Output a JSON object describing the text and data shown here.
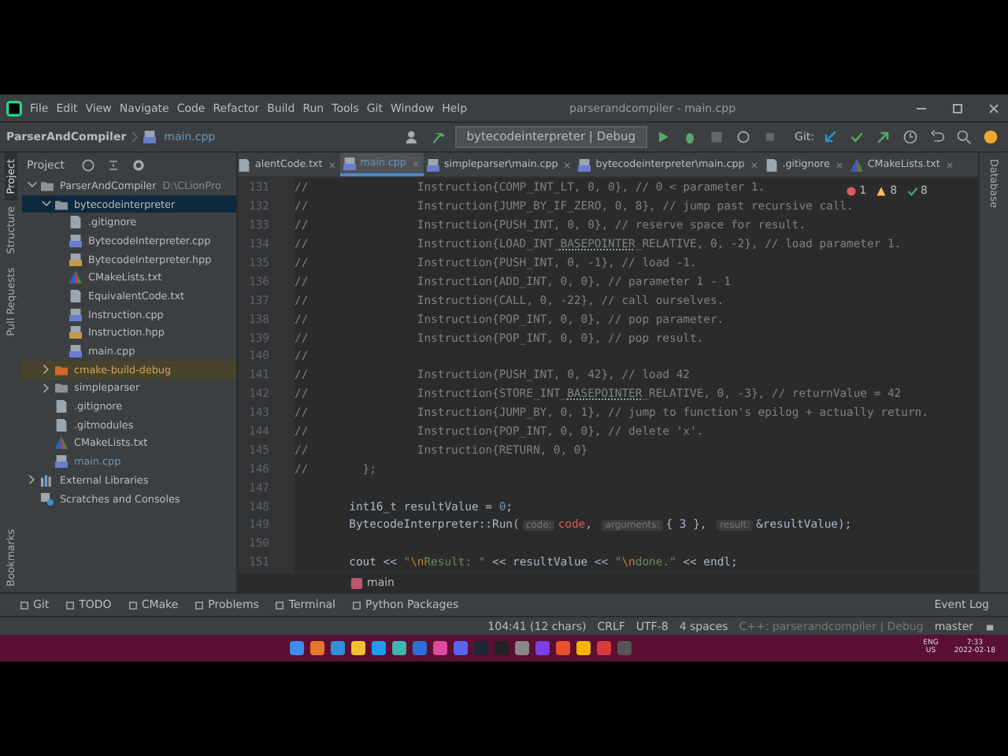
{
  "window": {
    "title": "parserandcompiler - main.cpp"
  },
  "menu": [
    "File",
    "Edit",
    "View",
    "Navigate",
    "Code",
    "Refactor",
    "Build",
    "Run",
    "Tools",
    "Git",
    "Window",
    "Help"
  ],
  "breadcrumb": [
    "ParserAndCompiler",
    "main.cpp"
  ],
  "run_config": "bytecodeinterpreter | Debug",
  "git_label": "Git:",
  "left_stripe": [
    {
      "label": "Project",
      "selected": true
    },
    {
      "label": "Structure",
      "selected": false
    },
    {
      "label": "Pull Requests",
      "selected": false
    }
  ],
  "left_stripe_bottom": [
    {
      "label": "Bookmarks",
      "selected": false
    }
  ],
  "right_stripe": [
    "Database"
  ],
  "project_panel": {
    "title": "Project"
  },
  "tabs": [
    {
      "label": "alentCode.txt",
      "kind": "txt",
      "selected": false
    },
    {
      "label": "main.cpp",
      "kind": "cpp",
      "selected": true
    },
    {
      "label": "simpleparser\\main.cpp",
      "kind": "cpp",
      "selected": false
    },
    {
      "label": "bytecodeinterpreter\\main.cpp",
      "kind": "cpp",
      "selected": false
    },
    {
      "label": ".gitignore",
      "kind": "git",
      "selected": false
    },
    {
      "label": "CMakeLists.txt",
      "kind": "cmake",
      "selected": false
    }
  ],
  "tree": [
    {
      "label": "ParserAndCompiler",
      "path": "D:\\CLionPro",
      "kind": "folder",
      "expanded": true,
      "selected": false,
      "excluded": false,
      "modified": false,
      "children": [
        {
          "label": "bytecodeinterpreter",
          "kind": "folder",
          "expanded": true,
          "selected": true,
          "excluded": false,
          "modified": false,
          "children": [
            {
              "label": ".gitignore",
              "kind": "git",
              "selected": false,
              "excluded": false,
              "modified": false
            },
            {
              "label": "BytecodeInterpreter.cpp",
              "kind": "cpp",
              "selected": false,
              "excluded": false,
              "modified": false
            },
            {
              "label": "BytecodeInterpreter.hpp",
              "kind": "hpp",
              "selected": false,
              "excluded": false,
              "modified": false
            },
            {
              "label": "CMakeLists.txt",
              "kind": "cmake",
              "selected": false,
              "excluded": false,
              "modified": false
            },
            {
              "label": "EquivalentCode.txt",
              "kind": "txt",
              "selected": false,
              "excluded": false,
              "modified": false
            },
            {
              "label": "Instruction.cpp",
              "kind": "cpp",
              "selected": false,
              "excluded": false,
              "modified": false
            },
            {
              "label": "Instruction.hpp",
              "kind": "hpp",
              "selected": false,
              "excluded": false,
              "modified": false
            },
            {
              "label": "main.cpp",
              "kind": "cpp",
              "selected": false,
              "excluded": false,
              "modified": false
            }
          ]
        },
        {
          "label": "cmake-build-debug",
          "kind": "excluded-folder",
          "expanded": false,
          "selected": false,
          "excluded": true,
          "modified": false
        },
        {
          "label": "simpleparser",
          "kind": "folder",
          "expanded": false,
          "selected": false,
          "excluded": false,
          "modified": false
        },
        {
          "label": ".gitignore",
          "kind": "git",
          "selected": false,
          "excluded": false,
          "modified": false
        },
        {
          "label": ".gitmodules",
          "kind": "txt",
          "selected": false,
          "excluded": false,
          "modified": false
        },
        {
          "label": "CMakeLists.txt",
          "kind": "cmake",
          "selected": false,
          "excluded": false,
          "modified": false
        },
        {
          "label": "main.cpp",
          "kind": "cpp",
          "selected": false,
          "excluded": false,
          "modified": true
        }
      ]
    },
    {
      "label": "External Libraries",
      "kind": "library",
      "expanded": false,
      "selected": false,
      "excluded": false,
      "modified": false
    },
    {
      "label": "Scratches and Consoles",
      "kind": "scratches",
      "selected": false,
      "excluded": false,
      "modified": false
    }
  ],
  "editor": {
    "inspections": {
      "errors": "1",
      "warnings": "8",
      "typos": "8"
    },
    "lines": [
      {
        "number": "131",
        "segments": [
          {
            "kind": "comment",
            "text": "//                Instruction{COMP_INT_LT, 0, 0}, // 0 < parameter 1."
          }
        ]
      },
      {
        "number": "132",
        "segments": [
          {
            "kind": "comment",
            "text": "//                Instruction{JUMP_BY_IF_ZERO, 0, 8}, // jump past recursive call."
          }
        ]
      },
      {
        "number": "133",
        "segments": [
          {
            "kind": "comment",
            "text": "//                Instruction{PUSH_INT, 0, 0}, // reserve space for result."
          }
        ]
      },
      {
        "number": "134",
        "segments": [
          {
            "kind": "comment",
            "text": "//                Instruction{LOAD_INT_"
          },
          {
            "kind": "typo",
            "text": "BASEPOINTER"
          },
          {
            "kind": "comment",
            "text": "_RELATIVE, 0, -2}, // load parameter 1."
          }
        ]
      },
      {
        "number": "135",
        "segments": [
          {
            "kind": "comment",
            "text": "//                Instruction{PUSH_INT, 0, -1}, // load -1."
          }
        ]
      },
      {
        "number": "136",
        "segments": [
          {
            "kind": "comment",
            "text": "//                Instruction{ADD_INT, 0, 0}, // parameter 1 - 1"
          }
        ]
      },
      {
        "number": "137",
        "segments": [
          {
            "kind": "comment",
            "text": "//                Instruction{CALL, 0, -22}, // call ourselves."
          }
        ]
      },
      {
        "number": "138",
        "segments": [
          {
            "kind": "comment",
            "text": "//                Instruction{POP_INT, 0, 0}, // pop parameter."
          }
        ]
      },
      {
        "number": "139",
        "segments": [
          {
            "kind": "comment",
            "text": "//                Instruction{POP_INT, 0, 0}, // pop result."
          }
        ]
      },
      {
        "number": "140",
        "segments": [
          {
            "kind": "comment",
            "text": "//"
          }
        ]
      },
      {
        "number": "141",
        "segments": [
          {
            "kind": "comment",
            "text": "//                Instruction{PUSH_INT, 0, 42}, // load 42"
          }
        ]
      },
      {
        "number": "142",
        "segments": [
          {
            "kind": "comment",
            "text": "//                Instruction{STORE_INT_"
          },
          {
            "kind": "typo",
            "text": "BASEPOINTER"
          },
          {
            "kind": "comment",
            "text": "_RELATIVE, 0, -3}, // returnValue = 42"
          }
        ]
      },
      {
        "number": "143",
        "segments": [
          {
            "kind": "comment",
            "text": "//                Instruction{JUMP_BY, 0, 1}, // jump to function's epilog + actually return."
          }
        ]
      },
      {
        "number": "144",
        "segments": [
          {
            "kind": "comment",
            "text": "//                Instruction{POP_INT, 0, 0}, // delete 'x'."
          }
        ]
      },
      {
        "number": "145",
        "segments": [
          {
            "kind": "comment",
            "text": "//                Instruction{RETURN, 0, 0}"
          }
        ]
      },
      {
        "number": "146",
        "segments": [
          {
            "kind": "comment",
            "text": "//        };"
          }
        ]
      },
      {
        "number": "147"
      },
      {
        "number": "148",
        "segments": [
          {
            "kind": "plain",
            "text": "        int16_t resultValue = "
          },
          {
            "kind": "number",
            "text": "0"
          },
          {
            "kind": "plain",
            "text": ";"
          }
        ]
      },
      {
        "number": "149",
        "segments": [
          {
            "kind": "plain",
            "text": "        BytecodeInterpreter::Run("
          },
          {
            "kind": "hint",
            "text": "code:"
          },
          {
            "kind": "param",
            "text": "code"
          },
          {
            "kind": "plain",
            "text": ", "
          },
          {
            "kind": "hint",
            "text": "arguments:"
          },
          {
            "kind": "plain",
            "text": "{ 3 }, "
          },
          {
            "kind": "hint",
            "text": "result:"
          },
          {
            "kind": "plain",
            "text": "&resultValue);"
          }
        ]
      },
      {
        "number": "150"
      },
      {
        "number": "151",
        "segments": [
          {
            "kind": "plain",
            "text": "        cout << "
          },
          {
            "kind": "string",
            "text": "\""
          },
          {
            "kind": "escape",
            "text": "\\n"
          },
          {
            "kind": "string",
            "text": "Result: \""
          },
          {
            "kind": "plain",
            "text": " << resultValue << "
          },
          {
            "kind": "string",
            "text": "\""
          },
          {
            "kind": "escape",
            "text": "\\n"
          },
          {
            "kind": "string",
            "text": "done.\""
          },
          {
            "kind": "plain",
            "text": " << endl;"
          }
        ]
      }
    ],
    "scope": "main"
  },
  "tool_windows": [
    "Git",
    "TODO",
    "CMake",
    "Problems",
    "Terminal",
    "Python Packages"
  ],
  "event_log": "Event Log",
  "status_bar": {
    "position": "104:41 (12 chars)",
    "line_ending": "CRLF",
    "encoding": "UTF-8",
    "indent": "4 spaces",
    "context": "C++: parserandcompiler | Debug",
    "branch": "master"
  },
  "taskbar": {
    "language": "ENG",
    "region": "US",
    "time": "7:33",
    "date": "2022-02-18"
  }
}
